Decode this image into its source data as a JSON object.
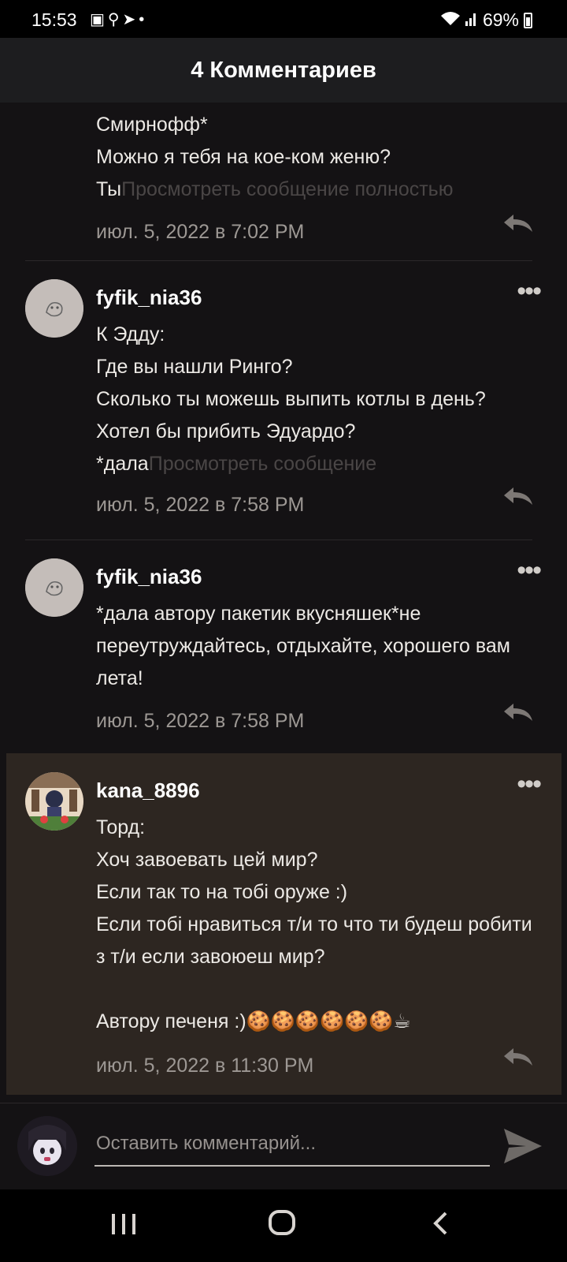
{
  "status_bar": {
    "time": "15:53",
    "notification_icons": [
      "gallery-icon",
      "search-icon",
      "telegram-icon",
      "dot"
    ],
    "battery": "69%"
  },
  "header": {
    "title": "4 Комментариев"
  },
  "comments": [
    {
      "body_lines": "Смирнофф*\nМожно я тебя на кое-ком женю?\nТы",
      "faded": "Просмотреть сообщение полностью",
      "date": "июл. 5, 2022 в 7:02 PM"
    },
    {
      "username": "fyfik_nia36",
      "body_lines": "К Эдду:\nГде вы нашли Ринго?\nСколько ты можешь выпить котлы в день?\nХотел бы прибить Эдуардо?\n*дала",
      "faded": "Просмотреть сообщение",
      "date": "июл. 5, 2022 в 7:58 PM"
    },
    {
      "username": "fyfik_nia36",
      "body_lines": "*дала автору пакетик вкусняшек*не переутруждайтесь, отдыхайте, хорошего вам лета!",
      "date": "июл. 5, 2022 в 7:58 PM"
    },
    {
      "username": "kana_8896",
      "body_lines": "Торд:\nХоч завоевать цей мир?\nЕсли так то на тобі оруже :)\nЕсли тобі нравиться т/и то что ти будеш робити з т/и если завоюеш мир?\n\nАвтору печеня :)🍪🍪🍪🍪🍪🍪☕",
      "date": "июл. 5, 2022 в 11:30 PM"
    }
  ],
  "composer": {
    "placeholder": "Оставить комментарий..."
  },
  "colors": {
    "background": "#141214",
    "highlight": "#2d2621",
    "header": "#1d1d1f"
  }
}
